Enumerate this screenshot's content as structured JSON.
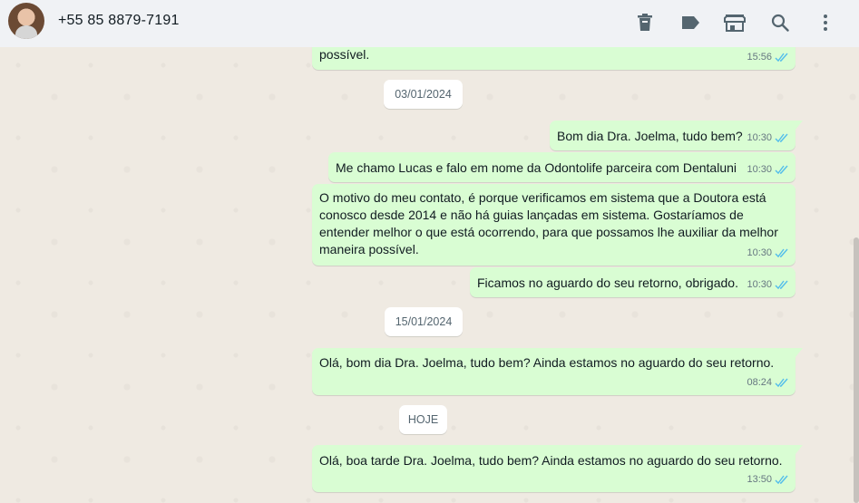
{
  "header": {
    "contact_name": "+55 85 8879-7191",
    "icons": [
      "delete-icon",
      "label-icon",
      "store-icon",
      "search-icon",
      "menu-icon"
    ]
  },
  "colors": {
    "outgoing_bubble": "#d9fdd3",
    "read_ticks": "#53bdeb",
    "header_bg": "#f0f2f5",
    "chat_bg": "#efeae2"
  },
  "messages": [
    {
      "text": "possível.",
      "time": "15:56"
    },
    {
      "date": "03/01/2024"
    },
    {
      "text": "Bom dia Dra. Joelma, tudo bem?",
      "time": "10:30"
    },
    {
      "text": "Me chamo Lucas e falo em nome da Odontolife parceira com Dentaluni",
      "time": "10:30"
    },
    {
      "text": "O motivo do meu contato, é porque verificamos em sistema que a Doutora está conosco desde 2014 e não há guias lançadas em sistema. Gostaríamos de entender melhor o que está ocorrendo, para que possamos lhe auxiliar da melhor maneira possível.",
      "time": "10:30"
    },
    {
      "text": "Ficamos no aguardo do seu retorno, obrigado.",
      "time": "10:30"
    },
    {
      "date": "15/01/2024"
    },
    {
      "text": "Olá, bom dia Dra. Joelma, tudo bem? Ainda estamos no aguardo do seu retorno.",
      "time": "08:24"
    },
    {
      "date": "HOJE"
    },
    {
      "text": "Olá, boa tarde Dra. Joelma, tudo bem? Ainda estamos no aguardo do seu retorno.",
      "time": "13:50"
    }
  ]
}
